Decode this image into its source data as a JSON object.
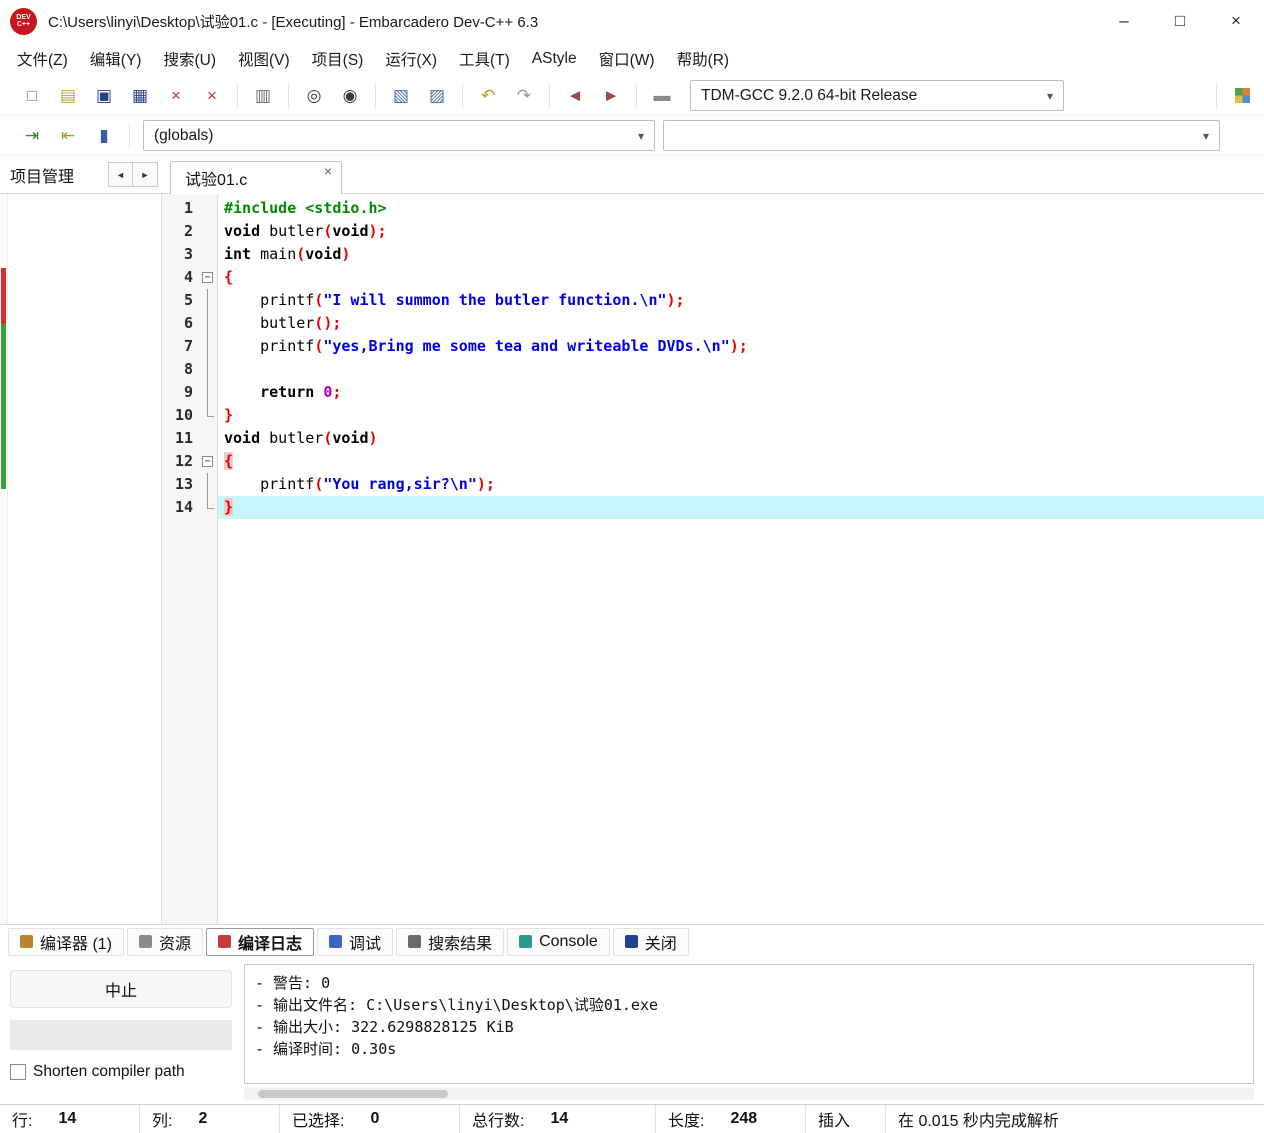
{
  "window": {
    "title": "C:\\Users\\linyi\\Desktop\\试验01.c - [Executing] - Embarcadero Dev-C++ 6.3",
    "logo_line1": "DEV",
    "logo_line2": "C++"
  },
  "icons": {
    "minimize": {
      "g": "–",
      "c": "#222222"
    },
    "maximize": {
      "g": "□",
      "c": "#222222"
    },
    "close": {
      "g": "×",
      "c": "#222222"
    },
    "chevron": {
      "g": "▾",
      "c": "#555555"
    },
    "tab_close": {
      "g": "×",
      "c": "#666666"
    },
    "arrow_left": {
      "g": "◄",
      "c": "#333333"
    },
    "arrow_right": {
      "g": "►",
      "c": "#333333"
    },
    "new-file-icon": {
      "g": "□",
      "c": "#7a7a7a"
    },
    "open-file-icon": {
      "g": "▤",
      "c": "#c8992e"
    },
    "save-icon": {
      "g": "▣",
      "c": "#27408b"
    },
    "save-all-icon": {
      "g": "▦",
      "c": "#27408b"
    },
    "close-file-icon": {
      "g": "×",
      "c": "#c03030"
    },
    "close-all-icon": {
      "g": "×",
      "c": "#c03030"
    },
    "print-icon": {
      "g": "▥",
      "c": "#6b6b6b"
    },
    "find-icon": {
      "g": "◎",
      "c": "#3a3a3a"
    },
    "replace-icon": {
      "g": "◉",
      "c": "#3a3a3a"
    },
    "goto-line-icon": {
      "g": "▧",
      "c": "#4a6faa"
    },
    "swap-header-icon": {
      "g": "▨",
      "c": "#4a6faa"
    },
    "undo-icon": {
      "g": "↶",
      "c": "#c09a18"
    },
    "redo-icon": {
      "g": "↷",
      "c": "#9a9a9a"
    },
    "back-icon": {
      "g": "◄",
      "c": "#9a4a4a"
    },
    "forward-icon": {
      "g": "►",
      "c": "#9a4a4a"
    },
    "remove-item-icon": {
      "g": "▬",
      "c": "#8a8a8a"
    },
    "jump-in-icon": {
      "g": "⇥",
      "c": "#2e8b2e"
    },
    "jump-out-icon": {
      "g": "⇤",
      "c": "#b09a20"
    },
    "columns-icon": {
      "g": "▮",
      "c": "#3a5aaa"
    }
  },
  "menu": {
    "items": [
      "文件(Z)",
      "编辑(Y)",
      "搜索(U)",
      "视图(V)",
      "项目(S)",
      "运行(X)",
      "工具(T)",
      "AStyle",
      "窗口(W)",
      "帮助(R)"
    ]
  },
  "toolbar1": {
    "groups": [
      [
        "new-file-icon",
        "open-file-icon",
        "save-icon",
        "save-all-icon",
        "close-file-icon",
        "close-all-icon"
      ],
      [
        "print-icon"
      ],
      [
        "find-icon",
        "replace-icon"
      ],
      [
        "goto-line-icon",
        "swap-header-icon"
      ],
      [
        "undo-icon",
        "redo-icon"
      ],
      [
        "back-icon",
        "forward-icon"
      ],
      [
        "remove-item-icon"
      ]
    ],
    "compiler": "TDM-GCC 9.2.0 64-bit Release"
  },
  "toolbar2": {
    "buttons": [
      "jump-in-icon",
      "jump-out-icon",
      "columns-icon"
    ],
    "globals": "(globals)",
    "members": ""
  },
  "project_panel": {
    "title": "项目管理"
  },
  "tabs": [
    {
      "label": "试验01.c"
    }
  ],
  "editor": {
    "lines": [
      {
        "n": "1",
        "fold": "",
        "tokens": [
          {
            "t": "#include <stdio.h>",
            "c": "pp"
          }
        ]
      },
      {
        "n": "2",
        "fold": "",
        "tokens": [
          {
            "t": "void",
            "c": "kw"
          },
          {
            "t": " butler",
            "c": "id"
          },
          {
            "t": "(",
            "c": "sym"
          },
          {
            "t": "void",
            "c": "kw"
          },
          {
            "t": ")",
            "c": "sym"
          },
          {
            "t": ";",
            "c": "sym"
          }
        ]
      },
      {
        "n": "3",
        "fold": "",
        "tokens": [
          {
            "t": "int",
            "c": "kw"
          },
          {
            "t": " main",
            "c": "id"
          },
          {
            "t": "(",
            "c": "sym"
          },
          {
            "t": "void",
            "c": "kw"
          },
          {
            "t": ")",
            "c": "sym"
          }
        ]
      },
      {
        "n": "4",
        "fold": "open",
        "tokens": [
          {
            "t": "{",
            "c": "sym"
          }
        ]
      },
      {
        "n": "5",
        "fold": "mid",
        "tokens": [
          {
            "t": "    printf",
            "c": "id"
          },
          {
            "t": "(",
            "c": "sym"
          },
          {
            "t": "\"I will summon the butler function.\\n\"",
            "c": "str"
          },
          {
            "t": ")",
            "c": "sym"
          },
          {
            "t": ";",
            "c": "sym"
          }
        ]
      },
      {
        "n": "6",
        "fold": "mid",
        "tokens": [
          {
            "t": "    butler",
            "c": "id"
          },
          {
            "t": "();",
            "c": "sym"
          }
        ]
      },
      {
        "n": "7",
        "fold": "mid",
        "tokens": [
          {
            "t": "    printf",
            "c": "id"
          },
          {
            "t": "(",
            "c": "sym"
          },
          {
            "t": "\"yes,Bring me some tea and writeable DVDs.\\n\"",
            "c": "str"
          },
          {
            "t": ");",
            "c": "sym"
          }
        ]
      },
      {
        "n": "8",
        "fold": "mid",
        "tokens": []
      },
      {
        "n": "9",
        "fold": "mid",
        "tokens": [
          {
            "t": "    ",
            "c": "id"
          },
          {
            "t": "return",
            "c": "kw"
          },
          {
            "t": " ",
            "c": "id"
          },
          {
            "t": "0",
            "c": "num"
          },
          {
            "t": ";",
            "c": "sym"
          }
        ]
      },
      {
        "n": "10",
        "fold": "end",
        "tokens": [
          {
            "t": "}",
            "c": "sym"
          }
        ]
      },
      {
        "n": "11",
        "fold": "",
        "tokens": [
          {
            "t": "void",
            "c": "kw"
          },
          {
            "t": " butler",
            "c": "id"
          },
          {
            "t": "(",
            "c": "sym"
          },
          {
            "t": "void",
            "c": "kw"
          },
          {
            "t": ")",
            "c": "sym"
          }
        ]
      },
      {
        "n": "12",
        "fold": "open",
        "tokens": [
          {
            "t": "{",
            "c": "brace"
          }
        ]
      },
      {
        "n": "13",
        "fold": "mid",
        "tokens": [
          {
            "t": "    printf",
            "c": "id"
          },
          {
            "t": "(",
            "c": "sym"
          },
          {
            "t": "\"You rang,sir?\\n\"",
            "c": "str"
          },
          {
            "t": ");",
            "c": "sym"
          }
        ]
      },
      {
        "n": "14",
        "fold": "end",
        "hl": true,
        "tokens": [
          {
            "t": "}",
            "c": "brace"
          }
        ]
      }
    ]
  },
  "bottom_tabs": [
    {
      "name": "compiler",
      "label": "编译器 (1)",
      "color": "#b8862a"
    },
    {
      "name": "resources",
      "label": "资源",
      "color": "#8a8a8a"
    },
    {
      "name": "compile-log",
      "label": "编译日志",
      "color": "#c43c3c",
      "active": true
    },
    {
      "name": "debug",
      "label": "调试",
      "color": "#3c64c4"
    },
    {
      "name": "search-results",
      "label": "搜索结果",
      "color": "#6a6a6a"
    },
    {
      "name": "console",
      "label": "Console",
      "color": "#2a9a8a"
    },
    {
      "name": "close",
      "label": "关闭",
      "color": "#27408b"
    }
  ],
  "compile_log": {
    "abort_label": "中止",
    "shorten_label": "Shorten compiler path",
    "lines": [
      "- 警告: 0",
      "- 输出文件名: C:\\Users\\linyi\\Desktop\\试验01.exe",
      "- 输出大小: 322.6298828125 KiB",
      "- 编译时间: 0.30s"
    ]
  },
  "status_bar": {
    "segments": [
      {
        "name": "status-line",
        "label": "行:",
        "value": "14"
      },
      {
        "name": "status-col",
        "label": "列:",
        "value": "2"
      },
      {
        "name": "status-sel",
        "label": "已选择:",
        "value": "0"
      },
      {
        "name": "status-total",
        "label": "总行数:",
        "value": "14"
      },
      {
        "name": "status-length",
        "label": "长度:",
        "value": "248"
      },
      {
        "name": "status-mode",
        "label": "",
        "value": "插入"
      },
      {
        "name": "status-parse",
        "label": "",
        "value": "在 0.015 秒内完成解析"
      }
    ]
  }
}
